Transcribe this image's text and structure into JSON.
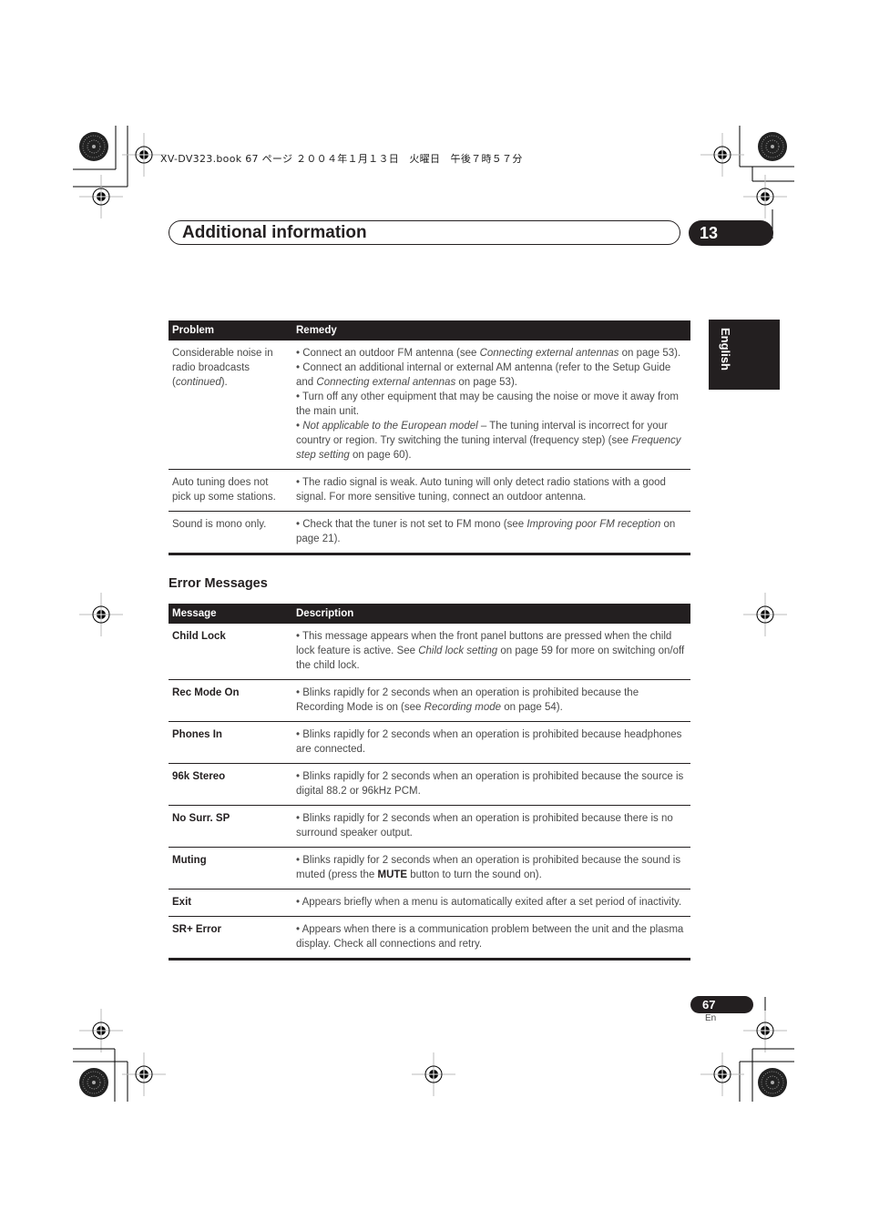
{
  "print_header": "XV-DV323.book  67 ページ  ２００４年１月１３日　火曜日　午後７時５７分",
  "chapter": {
    "title": "Additional information",
    "number": "13"
  },
  "language_tab": "English",
  "tuner_table": {
    "headers": [
      "Problem",
      "Remedy"
    ],
    "rows": [
      {
        "problem": [
          "Considerable noise in radio broadcasts (",
          "continued",
          ")."
        ],
        "remedy": [
          [
            "• Connect an outdoor FM antenna (see ",
            "Connecting external antennas",
            " on page 53)."
          ],
          [
            "• Connect an additional internal or external AM antenna (refer to the Setup Guide and ",
            "Connecting external antennas",
            " on page 53)."
          ],
          [
            "• Turn off any other equipment that may be causing the noise or move it away from the main unit.",
            "",
            ""
          ],
          [
            "• ",
            "Not applicable to the European model",
            " – The tuning interval is incorrect for your country or region. Try switching the tuning interval (frequency step) (see "
          ],
          [
            "",
            "Frequency step setting",
            " on page 60)."
          ]
        ]
      },
      {
        "problem": [
          "Auto tuning does not pick up some stations.",
          "",
          ""
        ],
        "remedy": [
          [
            "• The radio signal is weak. Auto tuning will only detect radio stations with a good signal. For more sensitive tuning, connect an outdoor antenna.",
            "",
            ""
          ]
        ]
      },
      {
        "problem": [
          "Sound is mono only.",
          "",
          ""
        ],
        "remedy": [
          [
            "• Check that the tuner is not set to FM mono (see ",
            "Improving poor FM reception",
            " on page 21)."
          ]
        ]
      }
    ]
  },
  "error_section": {
    "heading": "Error Messages",
    "headers": [
      "Message",
      "Description"
    ],
    "rows": [
      {
        "message": "Child Lock",
        "description": [
          "• This message appears when the front panel buttons are pressed when the child lock feature is active. See ",
          "Child lock setting",
          " on page 59 for more on switching on/off the child lock."
        ]
      },
      {
        "message": "Rec Mode On",
        "description": [
          "• Blinks rapidly for 2 seconds when an operation is prohibited because the Recording Mode is on (see ",
          "Recording mode",
          " on page 54)."
        ]
      },
      {
        "message": "Phones In",
        "description": [
          "• Blinks rapidly for 2 seconds when an operation is prohibited because headphones are connected.",
          "",
          ""
        ]
      },
      {
        "message": "96k Stereo",
        "description": [
          "• Blinks rapidly for 2 seconds when an operation is prohibited because the source is digital 88.2 or 96kHz PCM.",
          "",
          ""
        ]
      },
      {
        "message": "No Surr. SP",
        "description": [
          "• Blinks rapidly for 2 seconds when an operation is prohibited because there is no surround speaker output.",
          "",
          ""
        ]
      },
      {
        "message": "Muting",
        "description": [
          "• Blinks rapidly for 2 seconds when an operation is prohibited because the sound is muted (press the ",
          "MUTE",
          " button to turn the sound on)."
        ],
        "bold_middle": true
      },
      {
        "message": "Exit",
        "description": [
          "• Appears briefly when a menu is automatically exited after a set period of inactivity.",
          "",
          ""
        ]
      },
      {
        "message": "SR+ Error",
        "description": [
          "• Appears when there is a communication problem between the unit and the plasma display. Check all connections and retry.",
          "",
          ""
        ]
      }
    ]
  },
  "footer": {
    "page_number": "67",
    "page_lang": "En"
  }
}
